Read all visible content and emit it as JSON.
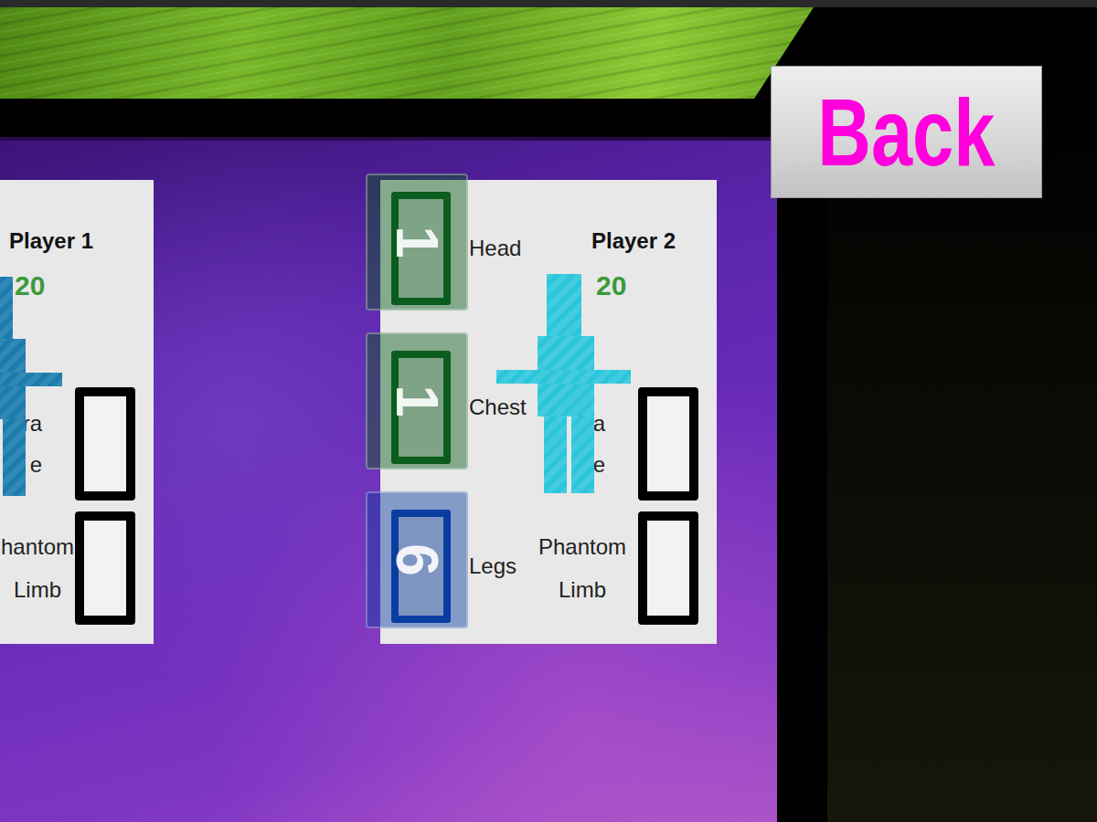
{
  "back_button": {
    "label": "Back"
  },
  "players": [
    {
      "name": "Player 1",
      "hp": "20",
      "color": "#1b7cae",
      "extra_label": [
        "ra",
        "e"
      ],
      "phantom_label": [
        "hantom",
        "Limb"
      ],
      "slots": []
    },
    {
      "name": "Player 2",
      "hp": "20",
      "color": "#2cc6dc",
      "extra_label": [
        "a",
        "e"
      ],
      "phantom_label": [
        "Phantom",
        "Limb"
      ],
      "slots": [
        {
          "label": "Head",
          "die": "1",
          "color": "#0b5d1e"
        },
        {
          "label": "Chest",
          "die": "1",
          "color": "#0b5d1e"
        },
        {
          "label": "Legs",
          "die": "6",
          "color": "#0a3da0"
        }
      ]
    }
  ]
}
